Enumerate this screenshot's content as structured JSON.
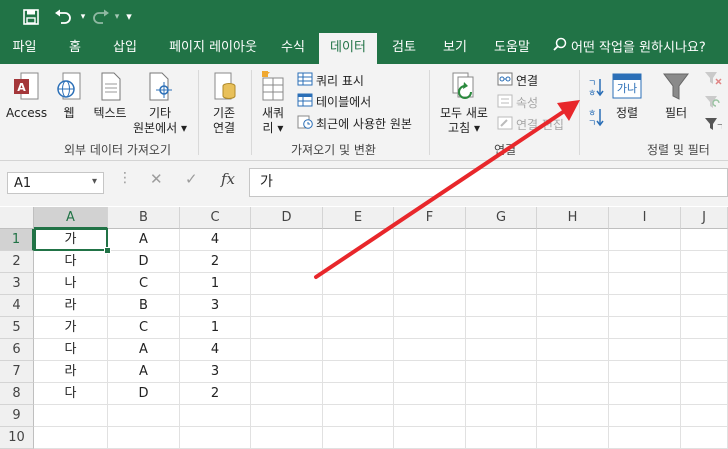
{
  "quick_access": {
    "save_icon": "save-icon",
    "undo_icon": "undo-icon",
    "redo_icon": "redo-icon",
    "customize_icon": "customize-qat-icon"
  },
  "tabs": [
    {
      "label": "파일"
    },
    {
      "label": "홈"
    },
    {
      "label": "삽입"
    },
    {
      "label": "페이지 레이아웃"
    },
    {
      "label": "수식"
    },
    {
      "label": "데이터",
      "active": true
    },
    {
      "label": "검토"
    },
    {
      "label": "보기"
    },
    {
      "label": "도움말"
    }
  ],
  "tell_me": "어떤 작업을 원하시나요?",
  "ribbon": {
    "external_data": {
      "access": "Access",
      "web": "웹",
      "text": "텍스트",
      "other1": "기타",
      "other2": "원본에서",
      "group_label": "외부 데이터 가져오기"
    },
    "existing": {
      "line1": "기존",
      "line2": "연결"
    },
    "get_transform": {
      "new_query1": "새쿼",
      "new_query2": "리",
      "show_query": "쿼리 표시",
      "from_table": "테이블에서",
      "recent": "최근에 사용한 원본",
      "group_label": "가져오기 및 변환"
    },
    "connections": {
      "refresh1": "모두 새로",
      "refresh2": "고침",
      "connections": "연결",
      "properties": "속성",
      "edit_links": "연결 편집",
      "group_label": "연결"
    },
    "sort_filter": {
      "sort": "정렬",
      "filter": "필터",
      "sort_icon_text": "가나",
      "group_label": "정렬 및 필터"
    }
  },
  "formula_bar": {
    "name_box": "A1",
    "formula": "가"
  },
  "columns": [
    "A",
    "B",
    "C",
    "D",
    "E",
    "F",
    "G",
    "H",
    "I",
    "J"
  ],
  "rows": [
    "1",
    "2",
    "3",
    "4",
    "5",
    "6",
    "7",
    "8",
    "9",
    "10"
  ],
  "cells": [
    [
      "가",
      "A",
      "4"
    ],
    [
      "다",
      "D",
      "2"
    ],
    [
      "나",
      "C",
      "1"
    ],
    [
      "라",
      "B",
      "3"
    ],
    [
      "가",
      "C",
      "1"
    ],
    [
      "다",
      "A",
      "4"
    ],
    [
      "라",
      "A",
      "3"
    ],
    [
      "다",
      "D",
      "2"
    ]
  ],
  "annotation": {
    "arrow_color": "#e8272b"
  },
  "colors": {
    "excel_green": "#217346"
  }
}
